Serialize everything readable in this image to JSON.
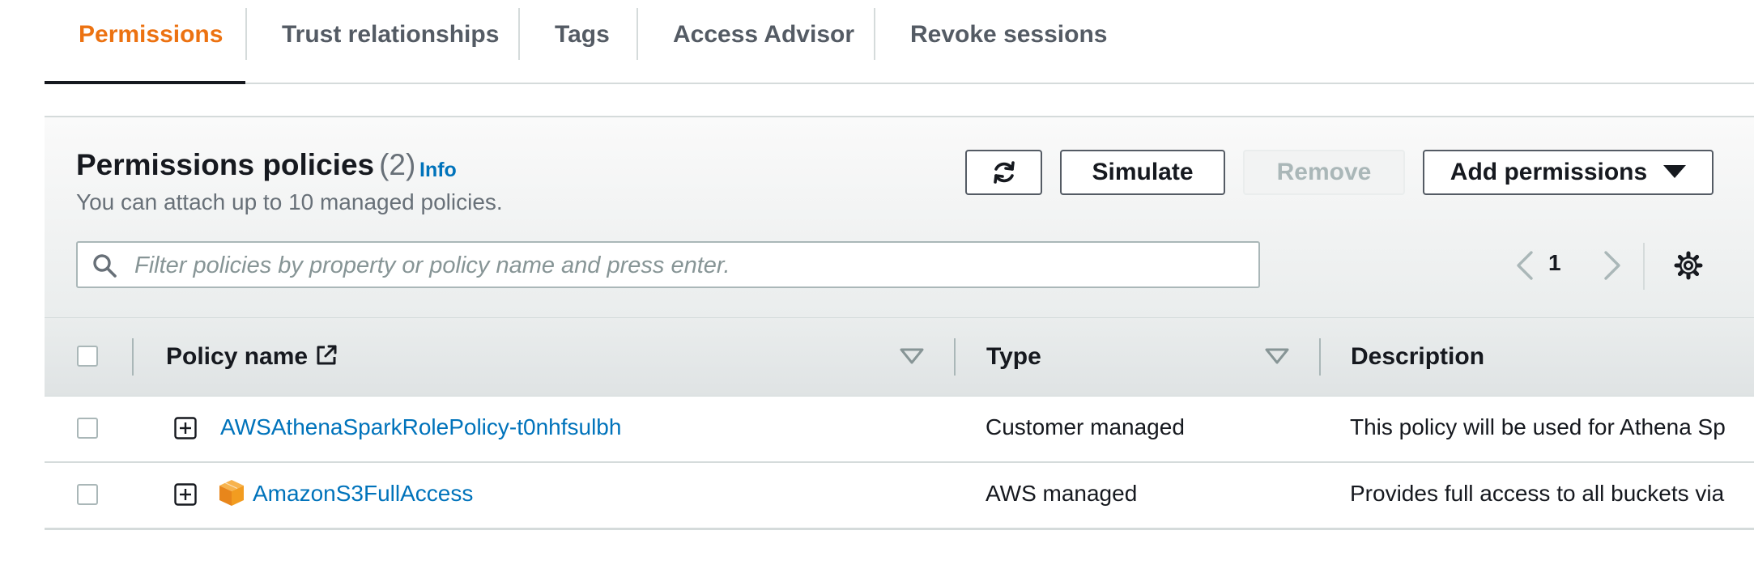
{
  "tabs": [
    {
      "label": "Permissions",
      "active": true
    },
    {
      "label": "Trust relationships",
      "active": false
    },
    {
      "label": "Tags",
      "active": false
    },
    {
      "label": "Access Advisor",
      "active": false
    },
    {
      "label": "Revoke sessions",
      "active": false
    }
  ],
  "panel": {
    "title": "Permissions policies",
    "count": "(2)",
    "info": "Info",
    "subtitle": "You can attach up to 10 managed policies.",
    "buttons": {
      "refresh_icon": "refresh-icon",
      "simulate": "Simulate",
      "remove": "Remove",
      "add_permissions": "Add permissions"
    },
    "search": {
      "placeholder": "Filter policies by property or policy name and press enter.",
      "value": ""
    },
    "pagination": {
      "current_page": "1"
    }
  },
  "table": {
    "columns": {
      "policy_name": "Policy name",
      "type": "Type",
      "description": "Description"
    },
    "rows": [
      {
        "name": "AWSAthenaSparkRolePolicy-t0nhfsulbh",
        "type": "Customer managed",
        "description": "This policy will be used for Athena Sp",
        "aws_icon": false
      },
      {
        "name": "AmazonS3FullAccess",
        "type": "AWS managed",
        "description": "Provides full access to all buckets via",
        "aws_icon": true
      }
    ]
  },
  "colors": {
    "accent": "#ec7211",
    "link": "#0073bb",
    "text": "#16191f",
    "muted": "#687078"
  }
}
